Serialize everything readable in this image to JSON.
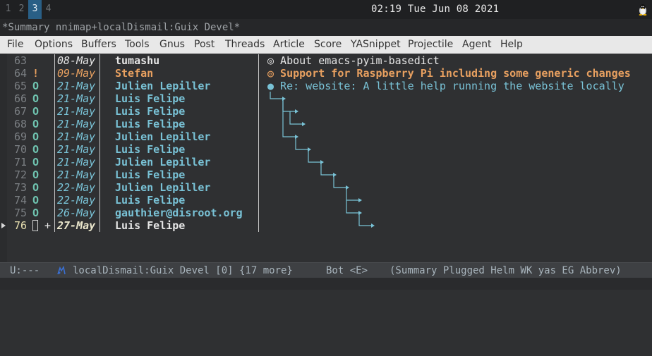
{
  "system_bar": {
    "workspaces": [
      "1",
      "2",
      "3",
      "4"
    ],
    "active_workspace": "3",
    "clock": "02:19 Tue Jun 08 2021",
    "tray_icon": "tux-icon"
  },
  "frame_title": "*Summary nnimap+localDismail:Guix Devel*",
  "menubar": [
    "File",
    "Options",
    "Buffers",
    "Tools",
    "Gnus",
    "Post",
    "Threads",
    "Article",
    "Score",
    "YASnippet",
    "Projectile",
    "Agent",
    "Help"
  ],
  "summary": {
    "rows": [
      {
        "line": "63",
        "mark": "",
        "date": "08-May",
        "from": "tumashu",
        "subject": "◎ About emacs-pyim-basedict",
        "state": "read"
      },
      {
        "line": "64",
        "mark": "!",
        "date": "09-May",
        "from": "Stefan",
        "subject": "◎ Support for Raspberry Pi including some generic changes",
        "state": "ticked"
      },
      {
        "line": "65",
        "mark": "O",
        "date": "21-May",
        "from": "Julien Lepiller",
        "subject": "● Re: website: A little help running the website locally",
        "state": "old"
      },
      {
        "line": "66",
        "mark": "O",
        "date": "21-May",
        "from": "Luis Felipe",
        "subject": "",
        "state": "old"
      },
      {
        "line": "67",
        "mark": "O",
        "date": "21-May",
        "from": "Luis Felipe",
        "subject": "",
        "state": "old"
      },
      {
        "line": "68",
        "mark": "O",
        "date": "21-May",
        "from": "Luis Felipe",
        "subject": "",
        "state": "old"
      },
      {
        "line": "69",
        "mark": "O",
        "date": "21-May",
        "from": "Julien Lepiller",
        "subject": "",
        "state": "old"
      },
      {
        "line": "70",
        "mark": "O",
        "date": "21-May",
        "from": "Luis Felipe",
        "subject": "",
        "state": "old"
      },
      {
        "line": "71",
        "mark": "O",
        "date": "21-May",
        "from": "Julien Lepiller",
        "subject": "",
        "state": "old"
      },
      {
        "line": "72",
        "mark": "O",
        "date": "21-May",
        "from": "Luis Felipe",
        "subject": "",
        "state": "old"
      },
      {
        "line": "73",
        "mark": "O",
        "date": "22-May",
        "from": "Julien Lepiller",
        "subject": "",
        "state": "old"
      },
      {
        "line": "74",
        "mark": "O",
        "date": "22-May",
        "from": "Luis Felipe",
        "subject": "",
        "state": "old"
      },
      {
        "line": "75",
        "mark": "O",
        "date": "26-May",
        "from": "gauthier@disroot.org",
        "subject": "",
        "state": "old"
      },
      {
        "line": "76",
        "mark": "",
        "score": "+",
        "date": "27-May",
        "from": "Luis Felipe",
        "subject": "",
        "state": "current"
      }
    ]
  },
  "mode_line": {
    "status": "U:---",
    "buffer": "localDismail:Guix Devel [0] {17 more}",
    "position": "Bot <E>",
    "modes": "(Summary Plugged Helm WK yas EG Abbrev)"
  },
  "colors": {
    "background": "#2f3032",
    "unread_blue": "#79c2d6",
    "ticked_orange": "#e8a060",
    "active_workspace": "#295f86"
  }
}
